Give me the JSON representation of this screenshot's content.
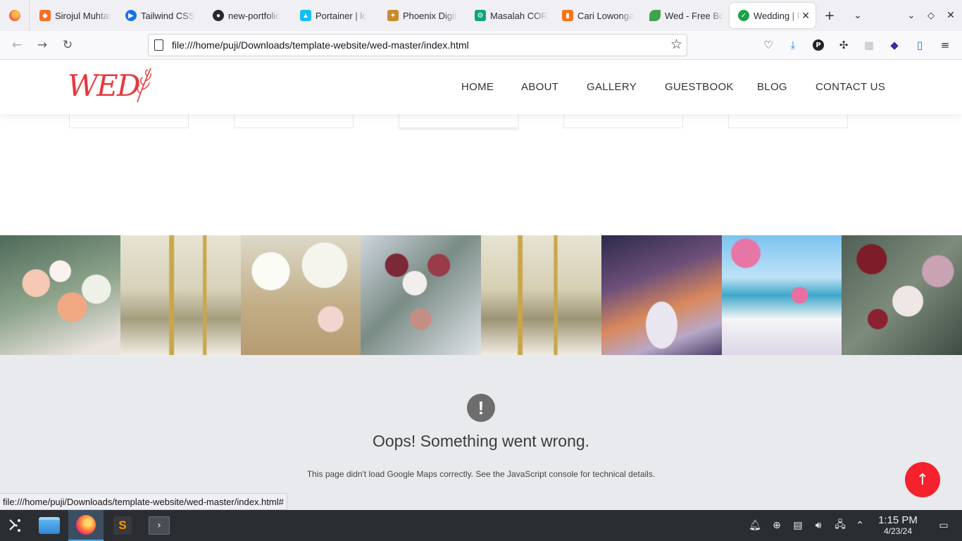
{
  "browser": {
    "tabs": [
      {
        "title": "Sirojul Muhtar",
        "icon": "gitlab-icon",
        "color": "#fc6d26"
      },
      {
        "title": "Tailwind CSS",
        "icon": "tailwind-icon",
        "color": "#1a73e8"
      },
      {
        "title": "new-portfolio",
        "icon": "github-icon",
        "color": "#24292f"
      },
      {
        "title": "Portainer | lo",
        "icon": "portainer-icon",
        "color": "#13bef9"
      },
      {
        "title": "Phoenix Digit",
        "icon": "phoenix-icon",
        "color": "#c98b2c"
      },
      {
        "title": "Masalah COR",
        "icon": "chatgpt-icon",
        "color": "#10a37f"
      },
      {
        "title": "Cari Lowonga",
        "icon": "page-icon",
        "color": "#f97316"
      },
      {
        "title": "Wed - Free Bo",
        "icon": "leaf-icon",
        "color": "#3fa34d"
      },
      {
        "title": "Wedding | F",
        "icon": "check-icon",
        "color": "#1aa34a"
      }
    ],
    "url": "file:///home/puji/Downloads/template-website/wed-master/index.html",
    "status_url": "file:///home/puji/Downloads/template-website/wed-master/index.html#"
  },
  "site": {
    "logo": "WED",
    "menu": [
      "HOME",
      "ABOUT",
      "GALLERY",
      "GUESTBOOK",
      "BLOG",
      "CONTACT US"
    ],
    "map_error": {
      "icon": "!",
      "title": "Oops! Something went wrong.",
      "message": "This page didn't load Google Maps correctly. See the JavaScript console for technical details."
    },
    "accent": "#e8383d",
    "scroll_top_color": "#f5222d"
  },
  "gallery": [
    {
      "icon": "peach-flower-box-image"
    },
    {
      "icon": "gold-candle-table-image"
    },
    {
      "icon": "baby-breath-jars-image"
    },
    {
      "icon": "bridal-bouquet-image"
    },
    {
      "icon": "gold-candle-table-image"
    },
    {
      "icon": "glassware-dinner-table-image"
    },
    {
      "icon": "beach-wedding-arch-image"
    },
    {
      "icon": "rose-bouquet-image"
    }
  ],
  "taskbar": {
    "time": "1:15 PM",
    "date": "4/23/24"
  }
}
